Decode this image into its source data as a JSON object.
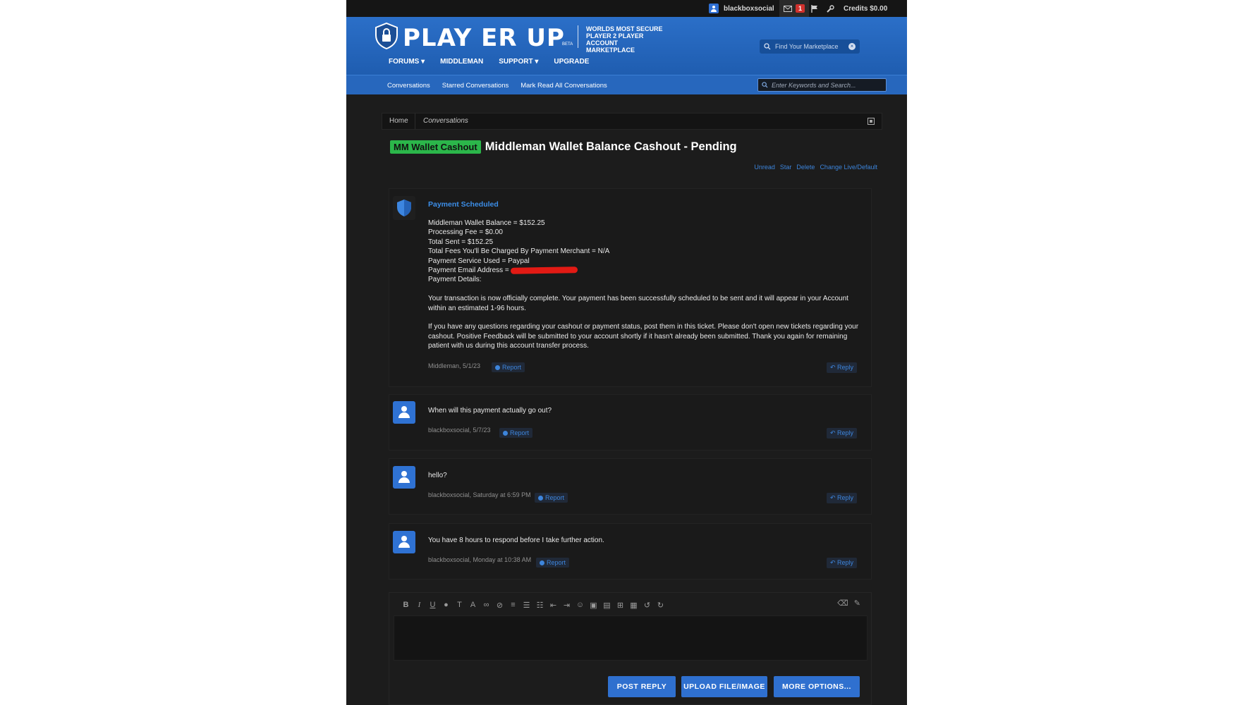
{
  "topbar": {
    "username": "blackboxsocial",
    "inbox_count": "1",
    "credits": "Credits $0.00"
  },
  "header": {
    "logo_text": "PLAY ER UP",
    "logo_beta": "BETA",
    "tagline": "WORLDS MOST SECURE PLAYER 2 PLAYER ACCOUNT MARKETPLACE",
    "marketplace_search_placeholder": "Find Your Marketplace",
    "nav": [
      "FORUMS ▾",
      "MIDDLEMAN",
      "SUPPORT ▾",
      "UPGRADE"
    ]
  },
  "subnav": {
    "links": [
      "Conversations",
      "Starred Conversations",
      "Mark Read All Conversations"
    ],
    "search_placeholder": "Enter Keywords and Search..."
  },
  "breadcrumb": [
    "Home",
    "Conversations"
  ],
  "thread": {
    "prefix": "MM Wallet Cashout",
    "title": "Middleman Wallet Balance Cashout - Pending",
    "actions": [
      "Unread",
      "Star",
      "Delete",
      "Change Live/Default"
    ]
  },
  "posts": [
    {
      "heading": "Payment Scheduled",
      "lines": [
        "Middleman Wallet Balance = $152.25",
        "Processing Fee = $0.00",
        "Total Sent = $152.25",
        "Total Fees You'll Be Charged By Payment Merchant = N/A",
        "Payment Service Used = Paypal",
        "Payment Email Address =",
        "Payment Details:"
      ],
      "para1": "Your transaction is now officially complete. Your payment has been successfully scheduled to be sent and it will appear in your Account within an estimated 1-96 hours.",
      "para2": "If you have any questions regarding your cashout or payment status, post them in this ticket. Please don't open new tickets regarding your cashout. Positive Feedback will be submitted to your account shortly if it hasn't already been submitted. Thank you again for remaining patient with us during this account transfer process.",
      "meta": "Middleman, 5/1/23"
    },
    {
      "text": "When will this payment actually go out?",
      "meta": "blackboxsocial, 5/7/23"
    },
    {
      "text": "hello?",
      "meta": "blackboxsocial, Saturday at 6:59 PM"
    },
    {
      "text": "You have 8 hours to respond before I take further action.",
      "meta": "blackboxsocial, Monday at 10:38 AM"
    }
  ],
  "labels": {
    "report": "Report",
    "reply": "Reply"
  },
  "editor": {
    "post_reply": "POST REPLY",
    "upload": "UPLOAD FILE/IMAGE",
    "more": "MORE OPTIONS..."
  },
  "colors": {
    "accent": "#2f70cf",
    "prefix_green": "#2bb64a",
    "link": "#3c84db"
  }
}
